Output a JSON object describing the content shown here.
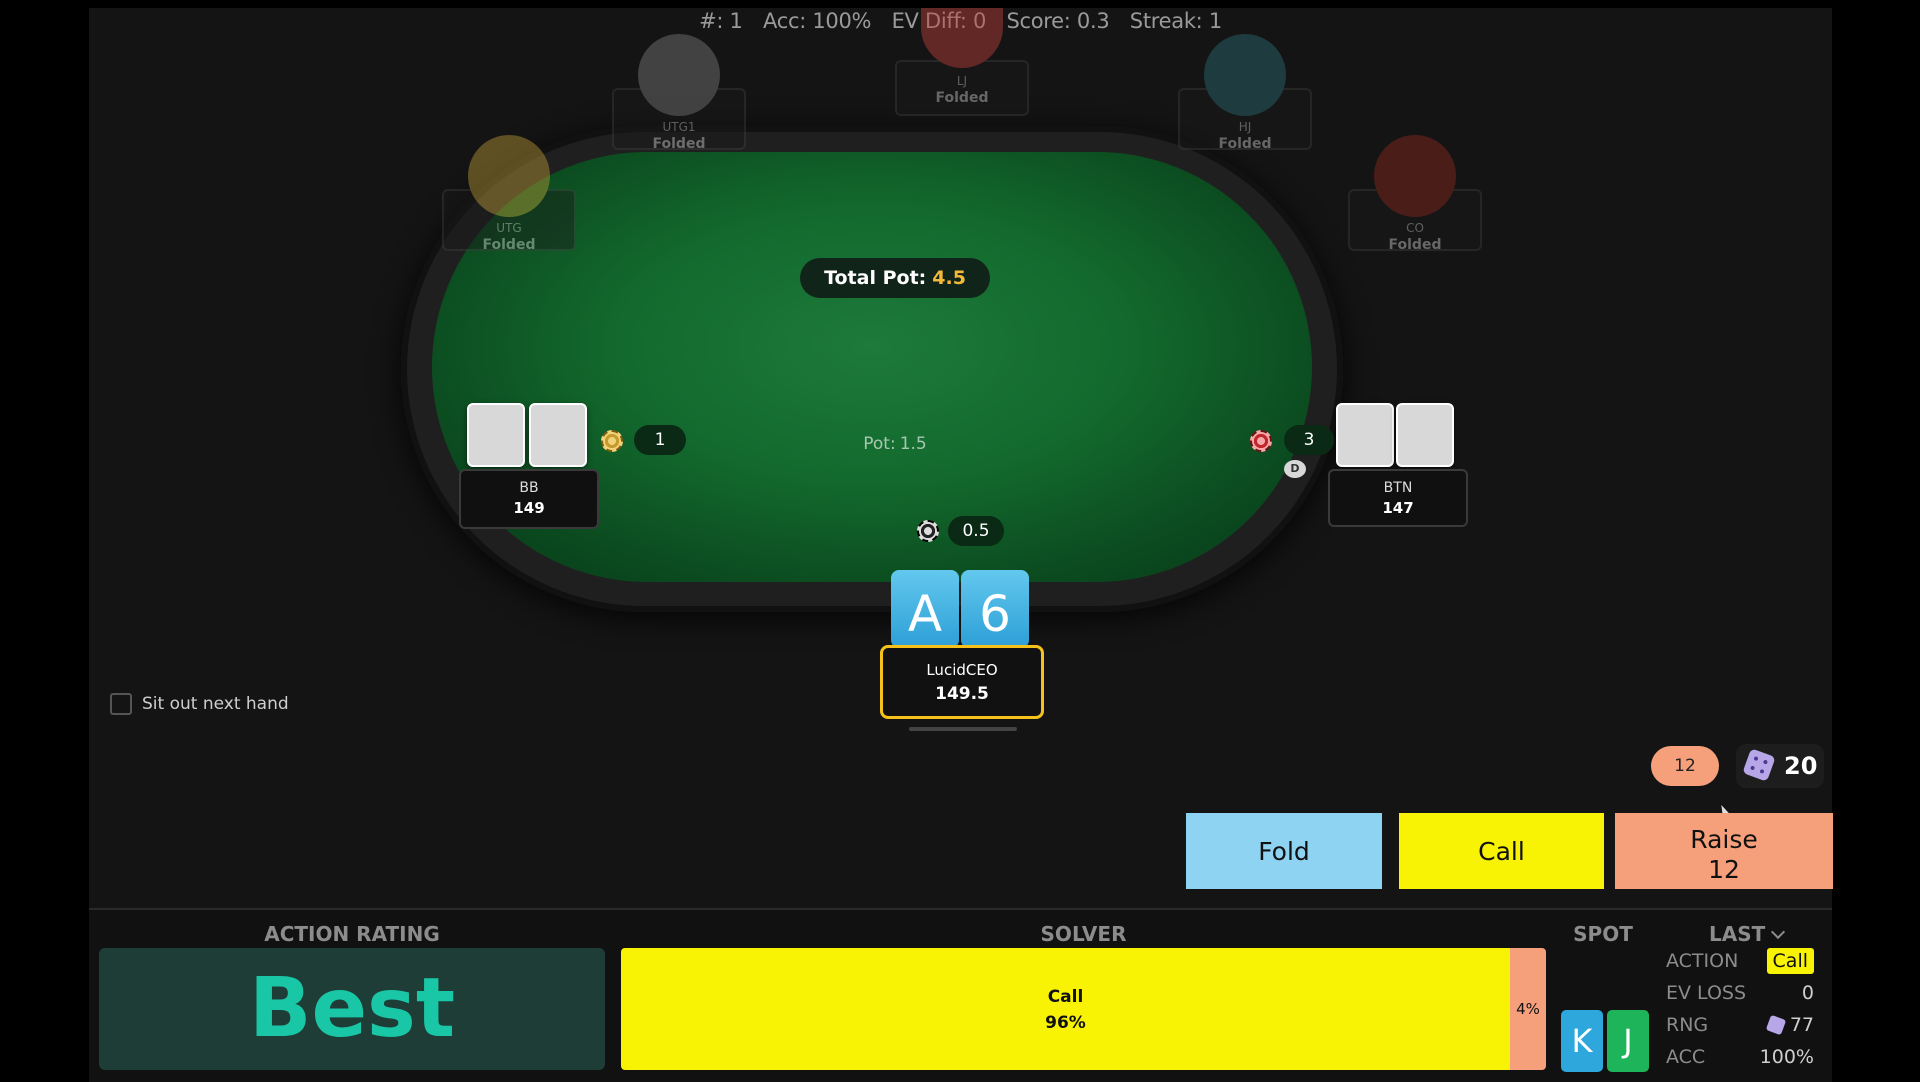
{
  "stats": {
    "hand": "#: 1",
    "acc": "Acc: 100%",
    "ev_diff": "EV Diff: 0",
    "score": "Score: 0.3",
    "streak": "Streak: 1"
  },
  "table": {
    "total_pot_label": "Total Pot:",
    "total_pot_value": "4.5",
    "pot_label": "Pot:",
    "pot_value": "1.5"
  },
  "folded_seats": [
    {
      "position": "UTG",
      "status": "Folded"
    },
    {
      "position": "UTG1",
      "status": "Folded"
    },
    {
      "position": "LJ",
      "status": "Folded"
    },
    {
      "position": "HJ",
      "status": "Folded"
    },
    {
      "position": "CO",
      "status": "Folded"
    }
  ],
  "bb": {
    "position": "BB",
    "stack": "149",
    "bet": "1"
  },
  "btn": {
    "position": "BTN",
    "stack": "147",
    "bet": "3",
    "dealer": "D"
  },
  "hero": {
    "name": "LucidCEO",
    "stack": "149.5",
    "bet": "0.5",
    "card1": "A",
    "card2": "6"
  },
  "sit_out": "Sit out next hand",
  "raise_size": "12",
  "rng_value": "20",
  "buttons": {
    "fold": "Fold",
    "call": "Call",
    "raise": "Raise",
    "raise_amount": "12"
  },
  "panel": {
    "action_rating_title": "ACTION RATING",
    "action_rating": "Best",
    "solver_title": "SOLVER",
    "solver_call_label": "Call",
    "solver_call_pct": "96%",
    "solver_raise_pct": "4%",
    "spot_title": "SPOT",
    "spot_card1": "K",
    "spot_card2": "J",
    "last_label": "LAST",
    "action_label": "ACTION",
    "action_value": "Call",
    "ev_loss_label": "EV LOSS",
    "ev_loss_value": "0",
    "rng_label": "RNG",
    "rng_value": "77",
    "acc_label": "ACC",
    "acc_value": "100%"
  },
  "colors": {
    "fold": "#8fd3f3",
    "call": "#f8f204",
    "raise": "#f69f7b",
    "best": "#19c6a5",
    "hero_border": "#f4c21b"
  }
}
